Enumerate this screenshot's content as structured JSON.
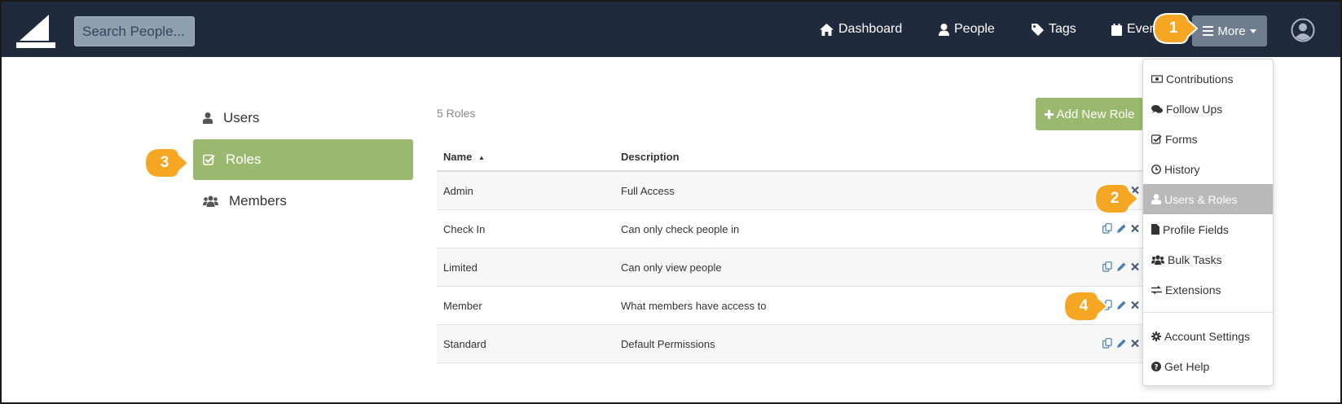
{
  "navbar": {
    "search_placeholder": "Search People...",
    "items": [
      {
        "label": "Dashboard",
        "icon": "home-icon"
      },
      {
        "label": "People",
        "icon": "person-icon"
      },
      {
        "label": "Tags",
        "icon": "tag-icon"
      },
      {
        "label": "Events",
        "icon": "calendar-icon"
      }
    ],
    "more_label": "More",
    "colors": {
      "background": "#1f2a3c",
      "more_button": "#6f7d8e"
    }
  },
  "sidebar": {
    "items": [
      {
        "label": "Users",
        "icon": "user-icon",
        "active": false
      },
      {
        "label": "Roles",
        "icon": "check-square-icon",
        "active": true
      },
      {
        "label": "Members",
        "icon": "users-icon",
        "active": false
      }
    ],
    "active_color": "#9ab96e"
  },
  "main": {
    "count_label": "5 Roles",
    "add_button_label": "Add New Role",
    "table": {
      "columns": [
        "Name",
        "Description"
      ],
      "sort_indicator": "▲",
      "rows": [
        {
          "name": "Admin",
          "description": "Full Access",
          "actions": [
            "delete"
          ]
        },
        {
          "name": "Check In",
          "description": "Can only check people in",
          "actions": [
            "copy",
            "edit",
            "delete"
          ]
        },
        {
          "name": "Limited",
          "description": "Can only view people",
          "actions": [
            "copy",
            "edit",
            "delete"
          ]
        },
        {
          "name": "Member",
          "description": "What members have access to",
          "actions": [
            "copy",
            "edit",
            "delete"
          ]
        },
        {
          "name": "Standard",
          "description": "Default Permissions",
          "actions": [
            "copy",
            "edit",
            "delete"
          ]
        }
      ]
    }
  },
  "dropdown": {
    "items": [
      {
        "label": "Contributions",
        "icon": "money-icon"
      },
      {
        "label": "Follow Ups",
        "icon": "comments-icon"
      },
      {
        "label": "Forms",
        "icon": "check-square-icon"
      },
      {
        "label": "History",
        "icon": "clock-icon"
      },
      {
        "label": "Users & Roles",
        "icon": "user-icon",
        "active": true
      },
      {
        "label": "Profile Fields",
        "icon": "file-icon"
      },
      {
        "label": "Bulk Tasks",
        "icon": "users-icon"
      },
      {
        "label": "Extensions",
        "icon": "exchange-icon"
      }
    ],
    "footer_items": [
      {
        "label": "Account Settings",
        "icon": "gear-icon"
      },
      {
        "label": "Get Help",
        "icon": "question-circle-icon"
      }
    ]
  },
  "callouts": [
    {
      "number": "1"
    },
    {
      "number": "2"
    },
    {
      "number": "3"
    },
    {
      "number": "4"
    }
  ],
  "callout_color": "#f5a623"
}
